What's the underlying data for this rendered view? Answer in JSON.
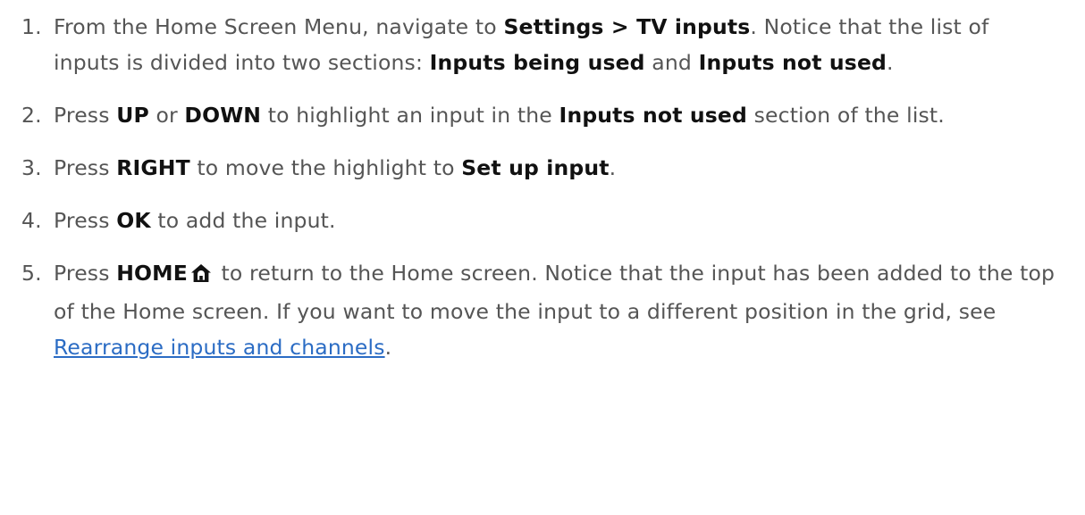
{
  "steps": [
    {
      "num": "1.",
      "parts": [
        {
          "t": "From the Home Screen Menu, navigate to "
        },
        {
          "t": "Settings > TV inputs",
          "b": true
        },
        {
          "t": ". Notice that the list of inputs is divided into two sections: "
        },
        {
          "t": "Inputs being used",
          "b": true
        },
        {
          "t": " and "
        },
        {
          "t": "Inputs not used",
          "b": true
        },
        {
          "t": "."
        }
      ]
    },
    {
      "num": "2.",
      "parts": [
        {
          "t": "Press "
        },
        {
          "t": "UP",
          "b": true
        },
        {
          "t": " or "
        },
        {
          "t": "DOWN",
          "b": true
        },
        {
          "t": " to highlight an input in the "
        },
        {
          "t": "Inputs not used",
          "b": true
        },
        {
          "t": " section of the list."
        }
      ]
    },
    {
      "num": "3.",
      "parts": [
        {
          "t": "Press "
        },
        {
          "t": "RIGHT",
          "b": true
        },
        {
          "t": " to move the highlight to "
        },
        {
          "t": "Set up input",
          "b": true
        },
        {
          "t": "."
        }
      ]
    },
    {
      "num": "4.",
      "parts": [
        {
          "t": "Press "
        },
        {
          "t": "OK",
          "b": true
        },
        {
          "t": " to add the input."
        }
      ]
    },
    {
      "num": "5.",
      "parts": [
        {
          "t": "Press "
        },
        {
          "t": "HOME",
          "b": true
        },
        {
          "icon": "home-icon"
        },
        {
          "t": " to return to the Home screen. Notice that the input has been added to the top of the Home screen. If you want to move the input to a different position in the grid, see "
        },
        {
          "t": "Rearrange inputs and channels",
          "link": true
        },
        {
          "t": "."
        }
      ]
    }
  ],
  "colors": {
    "text": "#555555",
    "bold": "#111111",
    "link": "#2b6cc4"
  }
}
